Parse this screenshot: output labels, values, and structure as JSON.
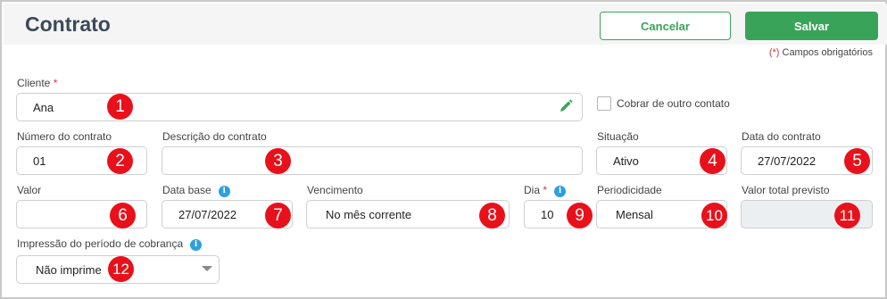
{
  "header": {
    "title": "Contrato",
    "cancel_label": "Cancelar",
    "save_label": "Salvar"
  },
  "required_note": {
    "star": "(*)",
    "text": " Campos obrigatórios"
  },
  "form": {
    "cliente": {
      "label": "Cliente",
      "value": "Ana",
      "marker": "1"
    },
    "cobrar": {
      "label": "Cobrar de outro contato",
      "checked": false
    },
    "numero": {
      "label": "Número do contrato",
      "value": "01",
      "marker": "2"
    },
    "descricao": {
      "label": "Descrição do contrato",
      "value": "",
      "marker": "3"
    },
    "situacao": {
      "label": "Situação",
      "value": "Ativo",
      "marker": "4"
    },
    "data_contrato": {
      "label": "Data do contrato",
      "value": "27/07/2022",
      "marker": "5"
    },
    "valor": {
      "label": "Valor",
      "value": "",
      "marker": "6"
    },
    "data_base": {
      "label": "Data base",
      "value": "27/07/2022",
      "marker": "7"
    },
    "vencimento": {
      "label": "Vencimento",
      "value": "No mês corrente",
      "marker": "8"
    },
    "dia": {
      "label": "Dia",
      "value": "10",
      "marker": "9"
    },
    "periodicidade": {
      "label": "Periodicidade",
      "value": "Mensal",
      "marker": "10"
    },
    "valor_total": {
      "label": "Valor total previsto",
      "value": "",
      "marker": "11"
    },
    "impressao": {
      "label": "Impressão do período de cobrança",
      "value": "Não imprime",
      "marker": "12"
    }
  },
  "info_glyph": "i",
  "required_star": "*",
  "colors": {
    "accent": "#3aa35a",
    "marker": "#e8111b",
    "info": "#2d9fe0",
    "required": "#d9363e",
    "title": "#3c4a5a"
  },
  "icons": [
    "pencil-icon",
    "info-icon",
    "chevron-down-icon"
  ]
}
